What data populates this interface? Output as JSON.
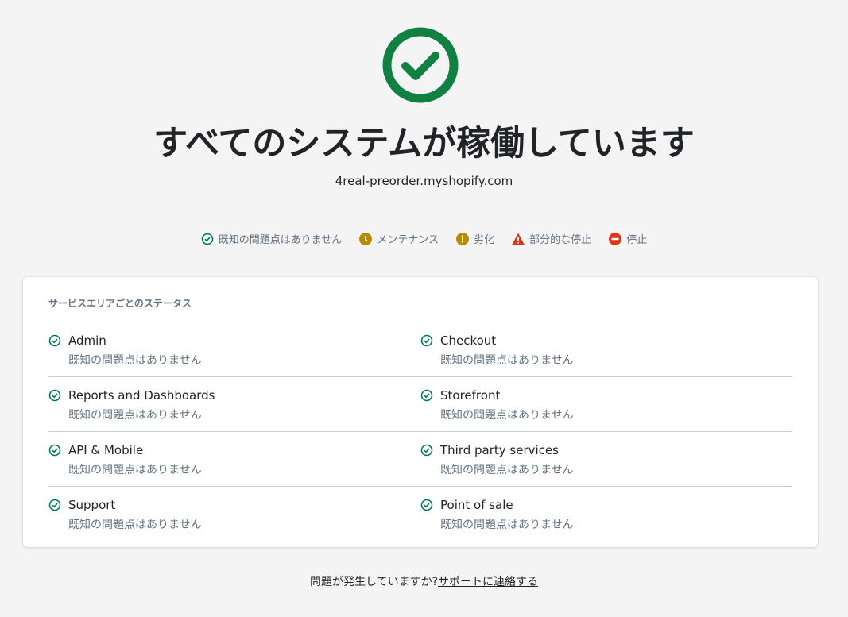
{
  "colors": {
    "ok": "#007a5a",
    "hero": "#108043",
    "maintenance": "#b98900",
    "degraded": "#b98900",
    "partial": "#de3618",
    "outage": "#de3618"
  },
  "header": {
    "title": "すべてのシステムが稼働しています",
    "domain": "4real-preorder.myshopify.com",
    "icon": "check-circle-icon"
  },
  "legend": [
    {
      "label": "既知の問題点はありません",
      "icon": "check-circle-icon"
    },
    {
      "label": "メンテナンス",
      "icon": "clock-icon"
    },
    {
      "label": "劣化",
      "icon": "exclamation-circle-icon"
    },
    {
      "label": "部分的な停止",
      "icon": "warning-triangle-icon"
    },
    {
      "label": "停止",
      "icon": "minus-circle-icon"
    }
  ],
  "card": {
    "title": "サービスエリアごとのステータス",
    "rows": [
      [
        {
          "name": "Admin",
          "status": "既知の問題点はありません"
        },
        {
          "name": "Checkout",
          "status": "既知の問題点はありません"
        }
      ],
      [
        {
          "name": "Reports and Dashboards",
          "status": "既知の問題点はありません"
        },
        {
          "name": "Storefront",
          "status": "既知の問題点はありません"
        }
      ],
      [
        {
          "name": "API & Mobile",
          "status": "既知の問題点はありません"
        },
        {
          "name": "Third party services",
          "status": "既知の問題点はありません"
        }
      ],
      [
        {
          "name": "Support",
          "status": "既知の問題点はありません"
        },
        {
          "name": "Point of sale",
          "status": "既知の問題点はありません"
        }
      ]
    ]
  },
  "footer": {
    "text": "問題が発生していますか?",
    "link": "サポートに連絡する"
  }
}
